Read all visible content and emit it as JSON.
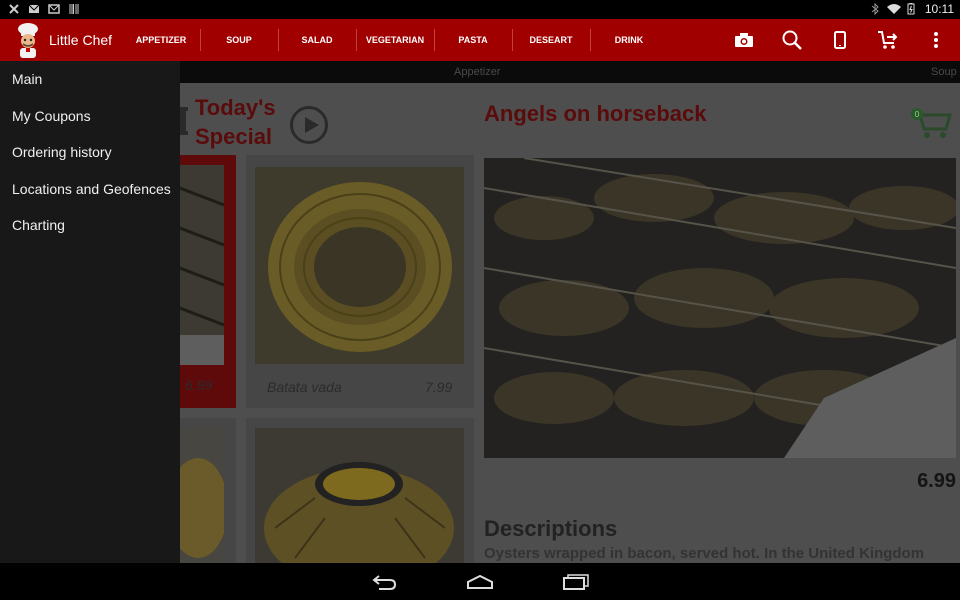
{
  "status_bar": {
    "time": "10:11",
    "left_icons": [
      "close-x-icon",
      "mail-icon",
      "gmail-icon",
      "barcode-icon"
    ],
    "right_icons": [
      "bluetooth-icon",
      "wifi-icon",
      "battery-icon"
    ]
  },
  "app": {
    "title": "Little Chef"
  },
  "tabs": [
    "APPETIZER",
    "SOUP",
    "SALAD",
    "VEGETARIAN",
    "PASTA",
    "DESEART",
    "DRINK"
  ],
  "action_icons": [
    "camera-icon",
    "search-icon",
    "phone-icon",
    "cart-forward-icon",
    "overflow-menu-icon"
  ],
  "sub_tabs": {
    "current": "Appetizer",
    "next": "Soup"
  },
  "specials": {
    "title_line1": "Today's",
    "title_line2": "Special",
    "cards": [
      {
        "name": "",
        "price": "6.99",
        "highlighted": true
      },
      {
        "name": "Batata vada",
        "price": "7.99",
        "highlighted": false
      }
    ]
  },
  "product": {
    "title": "Angels on horseback",
    "cart_count": "0",
    "price": "6.99",
    "desc_title": "Descriptions",
    "desc_text": "Oysters wrapped in bacon, served hot. In the United Kingdom"
  },
  "drawer": {
    "items": [
      "Main",
      "My Coupons",
      "Ordering history",
      "Locations and Geofences",
      "Charting"
    ]
  },
  "colors": {
    "action_bar": "#a00000",
    "drawer_bg": "#181818",
    "accent_dark_red": "#5a0b0b"
  }
}
